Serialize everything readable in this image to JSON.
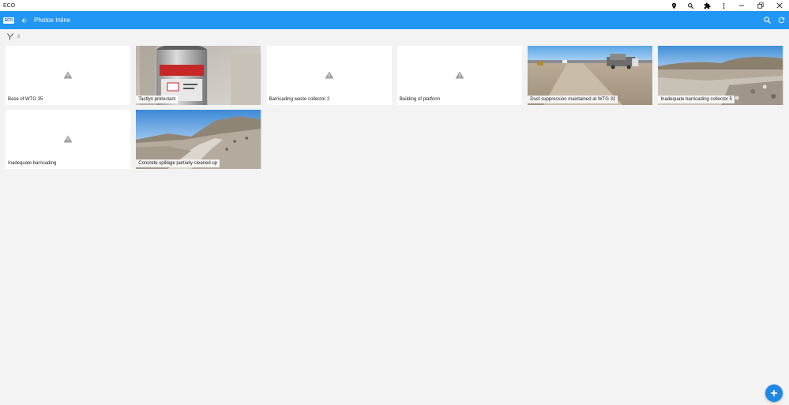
{
  "window": {
    "title": "ECO"
  },
  "toolbar_icons": [
    "location-pin-icon",
    "search-icon",
    "puzzle-icon",
    "more-vertical-icon"
  ],
  "window_controls": [
    "minimize-icon",
    "restore-icon",
    "close-icon"
  ],
  "appbar": {
    "logo_text": "ECO",
    "title": "Photos Inline",
    "actions": [
      "search-icon",
      "refresh-icon"
    ],
    "background": "#2196f3"
  },
  "filter": {
    "icon": "filter-icon",
    "count": "8"
  },
  "photos": [
    {
      "caption": "Base of WTG 35",
      "has_image": false
    },
    {
      "caption": "Tactlyn protectant",
      "has_image": true
    },
    {
      "caption": "Barricading waste collector 2",
      "has_image": false
    },
    {
      "caption": "Building of platform",
      "has_image": false
    },
    {
      "caption": "Dust suppression maintained at WTG 32",
      "has_image": true
    },
    {
      "caption": "Inadequate barricading collector 5",
      "has_image": true
    },
    {
      "caption": "Inadequate barricading",
      "has_image": false
    },
    {
      "caption": "Concrete spillage partially cleaned up",
      "has_image": true
    }
  ],
  "fab": {
    "icon": "plus-icon",
    "color": "#1e88e5"
  }
}
